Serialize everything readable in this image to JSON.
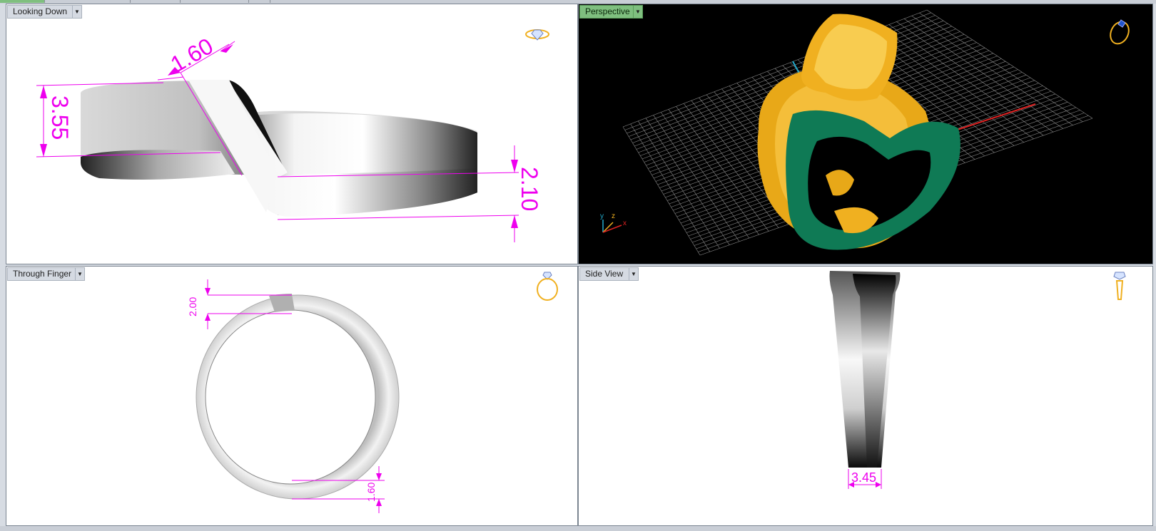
{
  "viewports": {
    "top_left": {
      "label": "Looking Down",
      "dimensions": [
        "1.60",
        "3.55",
        "2.10"
      ]
    },
    "top_right": {
      "label": "Perspective",
      "axis_labels": {
        "y": "y",
        "z": "z",
        "x": "x"
      }
    },
    "bottom_left": {
      "label": "Through Finger",
      "dimensions": [
        "2.00",
        "1.60"
      ]
    },
    "bottom_right": {
      "label": "Side View",
      "dimensions": [
        "3.45"
      ]
    }
  },
  "colors": {
    "dimension": "#ee00ee",
    "metal_gold": "#f0b020",
    "band_green": "#0f7a55",
    "grid_line": "#8a8a8a",
    "axis_red": "#dd2222",
    "axis_cyan": "#22aacc",
    "label_active": "#7fbf7f"
  },
  "icons": {
    "top_left": "ring-top-view-icon",
    "top_right": "ring-perspective-icon",
    "bottom_left": "ring-front-view-icon",
    "bottom_right": "ring-side-view-icon"
  }
}
